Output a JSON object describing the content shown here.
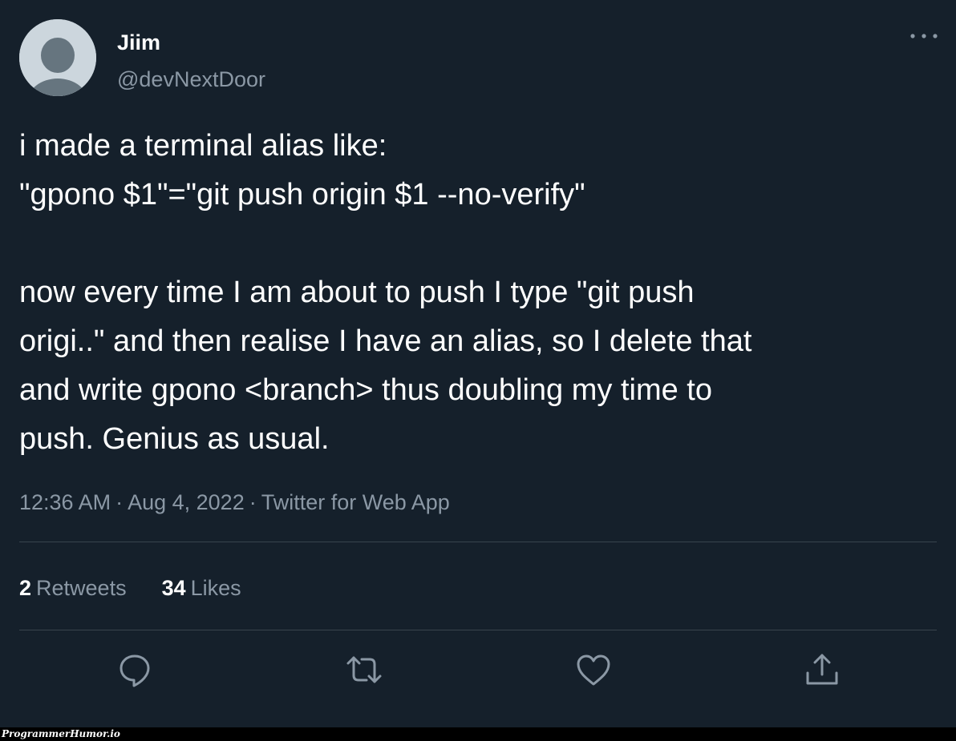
{
  "author": {
    "display_name": "Jiim",
    "handle": "@devNextDoor",
    "avatar_icon": "default-profile-icon"
  },
  "tweet": {
    "lines": [
      "i made a terminal alias like:",
      "\"gpono $1\"=\"git push origin $1 --no-verify\"",
      "",
      "now every time I am about to push I type \"git push",
      "origi..\" and then realise I have an alias, so I delete that",
      "and write gpono <branch> thus doubling my time to",
      "push. Genius as usual."
    ]
  },
  "meta": {
    "time": "12:36 AM",
    "separator": "·",
    "date": "Aug 4, 2022",
    "source": "Twitter for Web App"
  },
  "stats": {
    "retweets_count": "2",
    "retweets_label": "Retweets",
    "likes_count": "34",
    "likes_label": "Likes"
  },
  "actions": [
    "reply-icon",
    "retweet-icon",
    "like-icon",
    "share-icon"
  ],
  "colors": {
    "background": "#15202b",
    "primary_text": "#ffffff",
    "secondary_text": "#8b98a5",
    "divider": "#38444d"
  },
  "watermark": "ProgrammerHumor.io"
}
